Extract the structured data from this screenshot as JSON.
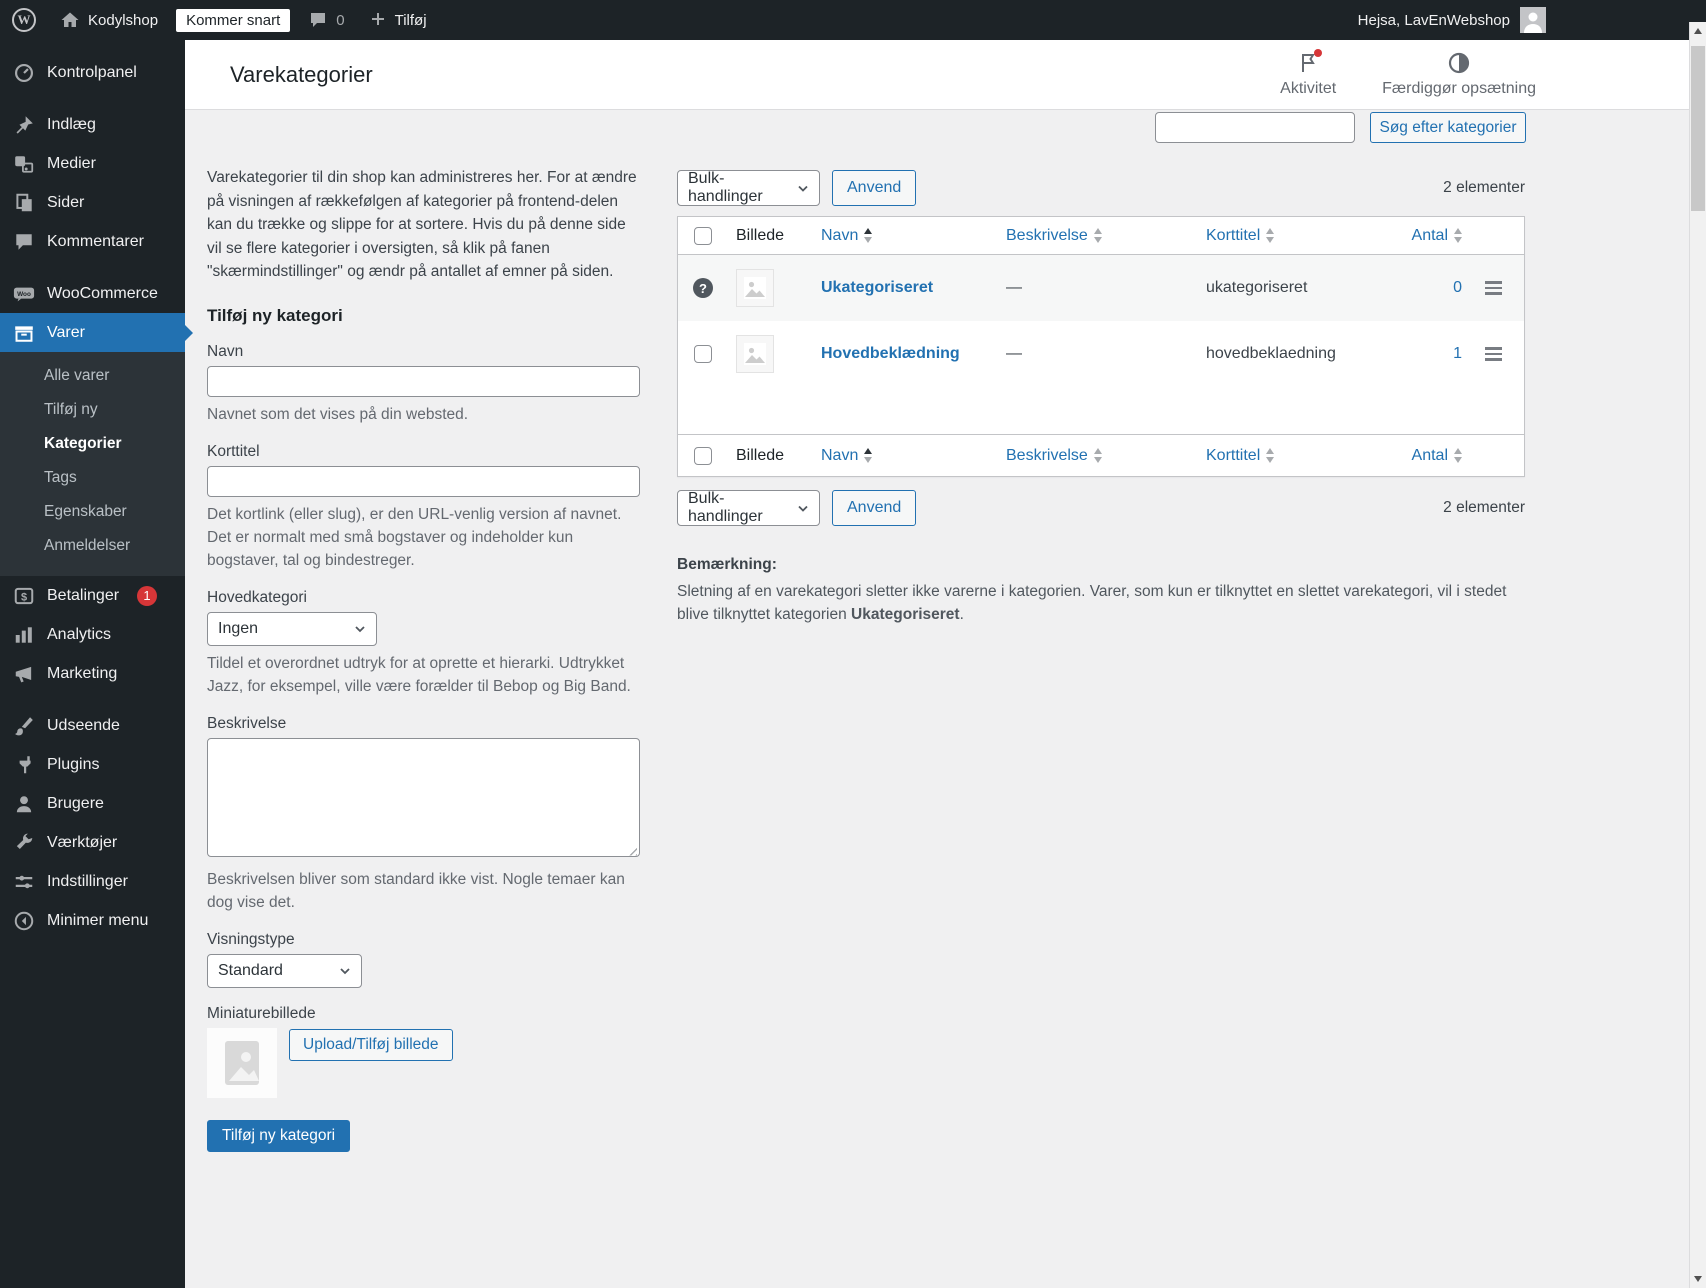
{
  "admin_bar": {
    "site_name": "Kodylshop",
    "coming_soon": "Kommer snart",
    "comment_count": "0",
    "new_item": "Tilføj",
    "greeting": "Hejsa, LavEnWebshop"
  },
  "sidebar": {
    "items": [
      {
        "label": "Kontrolpanel"
      },
      {
        "label": "Indlæg"
      },
      {
        "label": "Medier"
      },
      {
        "label": "Sider"
      },
      {
        "label": "Kommentarer"
      },
      {
        "label": "WooCommerce"
      },
      {
        "label": "Varer"
      },
      {
        "label": "Betalinger",
        "badge": "1"
      },
      {
        "label": "Analytics"
      },
      {
        "label": "Marketing"
      },
      {
        "label": "Udseende"
      },
      {
        "label": "Plugins"
      },
      {
        "label": "Brugere"
      },
      {
        "label": "Værktøjer"
      },
      {
        "label": "Indstillinger"
      },
      {
        "label": "Minimer menu"
      }
    ],
    "varer_submenu": [
      {
        "label": "Alle varer"
      },
      {
        "label": "Tilføj ny"
      },
      {
        "label": "Kategorier",
        "current": true
      },
      {
        "label": "Tags"
      },
      {
        "label": "Egenskaber"
      },
      {
        "label": "Anmeldelser"
      }
    ]
  },
  "header": {
    "title": "Varekategorier",
    "activity_label": "Aktivitet",
    "finish_setup_label": "Færdiggør opsætning"
  },
  "search": {
    "input_value": "",
    "button_label": "Søg efter kategorier"
  },
  "form": {
    "intro": "Varekategorier til din shop kan administreres her. For at ændre på visningen af rækkefølgen af kategorier på frontend-delen kan du trække og slippe for at sortere. Hvis du på denne side vil se flere kategorier i oversigten, så klik på fanen \"skærmindstillinger\" og ændr på antallet af emner på siden.",
    "heading": "Tilføj ny kategori",
    "name_label": "Navn",
    "name_help": "Navnet som det vises på din websted.",
    "slug_label": "Korttitel",
    "slug_help": "Det kortlink (eller slug), er den URL-venlig version af navnet. Det er normalt med små bogstaver og indeholder kun bogstaver, tal og bindestreger.",
    "parent_label": "Hovedkategori",
    "parent_value": "Ingen",
    "parent_help": "Tildel et overordnet udtryk for at oprette et hierarki. Udtrykket Jazz, for eksempel, ville være forælder til Bebop og Big Band.",
    "description_label": "Beskrivelse",
    "description_help": "Beskrivelsen bliver som standard ikke vist. Nogle temaer kan dog vise det.",
    "display_type_label": "Visningstype",
    "display_type_value": "Standard",
    "thumbnail_label": "Miniaturebillede",
    "upload_button": "Upload/Tilføj billede",
    "submit_button": "Tilføj ny kategori"
  },
  "table": {
    "bulk_actions_label": "Bulk-handlinger",
    "apply_button": "Anvend",
    "item_count": "2 elementer",
    "columns": [
      "Billede",
      "Navn",
      "Beskrivelse",
      "Korttitel",
      "Antal"
    ],
    "rows": [
      {
        "name": "Ukategoriseret",
        "description": "—",
        "slug": "ukategoriseret",
        "count": "0"
      },
      {
        "name": "Hovedbeklædning",
        "description": "—",
        "slug": "hovedbeklaedning",
        "count": "1"
      }
    ]
  },
  "note": {
    "title": "Bemærkning:",
    "text_before": "Sletning af en varekategori sletter ikke varerne i kategorien. Varer, som kun er tilknyttet en slettet varekategori, vil i stedet blive tilknyttet kategorien ",
    "bold": "Ukategoriseret",
    "text_after": "."
  },
  "colors": {
    "accent": "#2271b1",
    "admin_bar_bg": "#1d2327",
    "badge_red": "#d63638",
    "content_bg": "#f0f0f1",
    "table_stripe": "#f6f7f7"
  }
}
